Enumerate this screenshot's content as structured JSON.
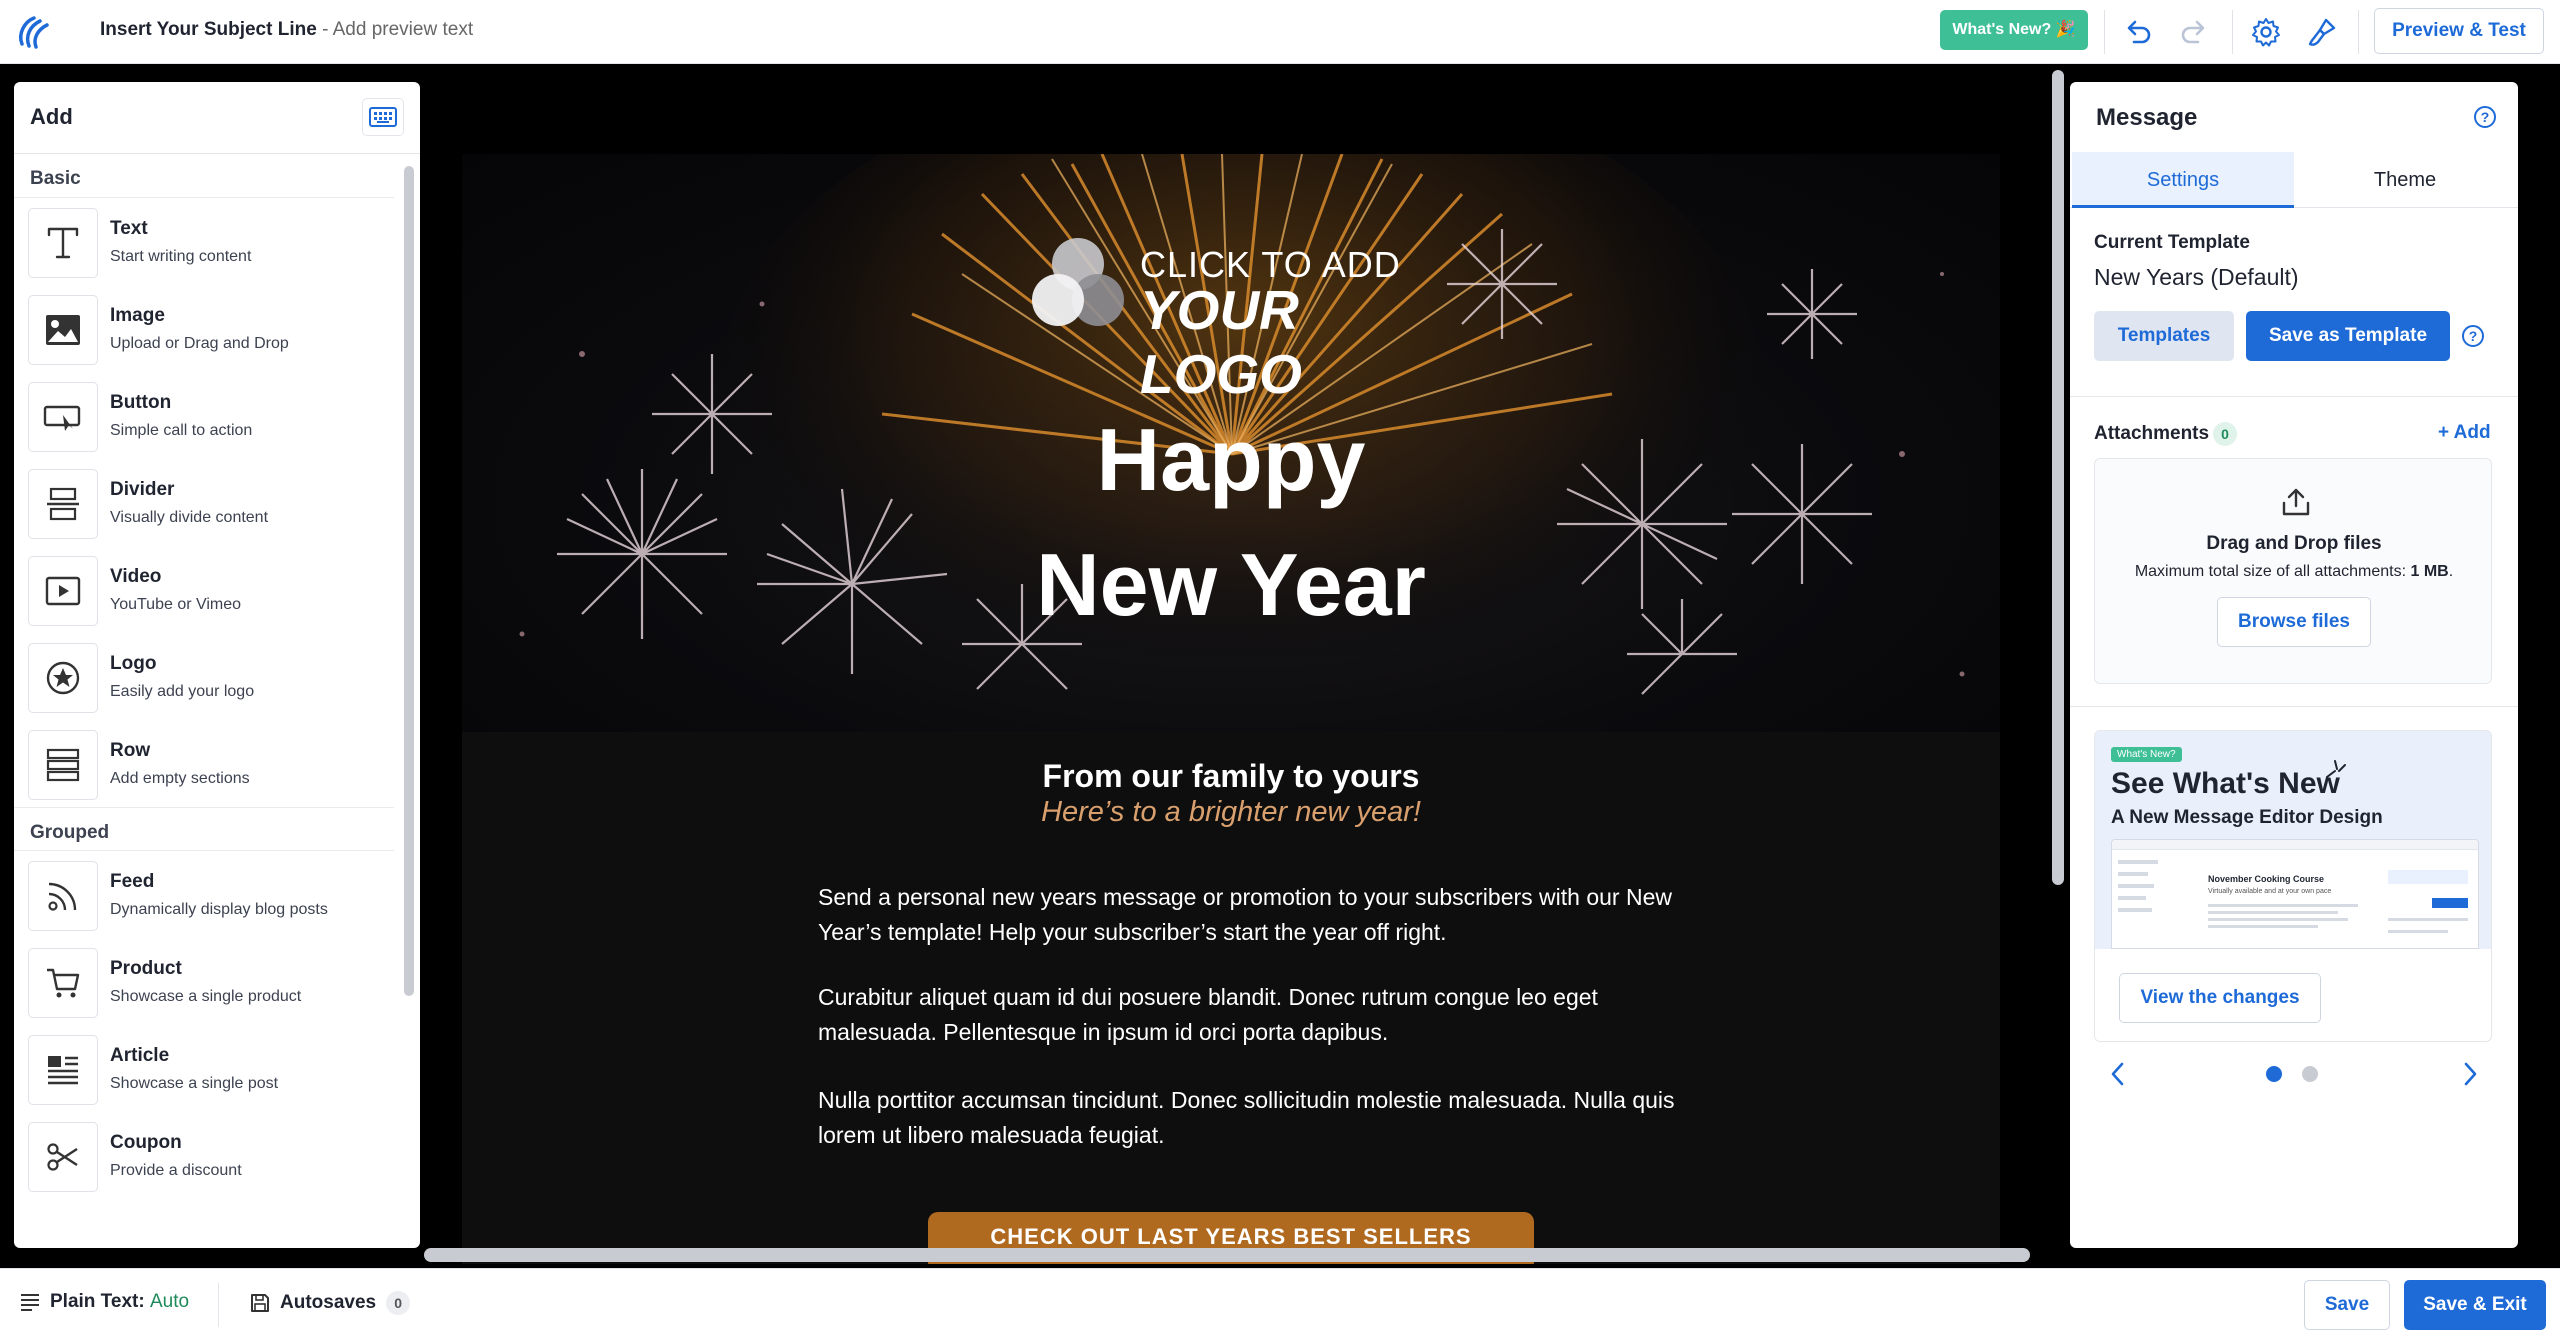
{
  "header": {
    "subject": "Insert Your Subject Line",
    "preview_text": " - Add preview text",
    "whats_new": "What's New? 🎉",
    "preview_test": "Preview & Test"
  },
  "add_panel": {
    "title": "Add",
    "sections": [
      {
        "title": "Basic",
        "items": [
          {
            "name": "Text",
            "desc": "Start writing content",
            "icon": "text-icon"
          },
          {
            "name": "Image",
            "desc": "Upload or Drag and Drop",
            "icon": "image-icon"
          },
          {
            "name": "Button",
            "desc": "Simple call to action",
            "icon": "button-icon"
          },
          {
            "name": "Divider",
            "desc": "Visually divide content",
            "icon": "divider-icon"
          },
          {
            "name": "Video",
            "desc": "YouTube or Vimeo",
            "icon": "video-icon"
          },
          {
            "name": "Logo",
            "desc": "Easily add your logo",
            "icon": "logo-icon"
          },
          {
            "name": "Row",
            "desc": "Add empty sections",
            "icon": "row-icon"
          }
        ]
      },
      {
        "title": "Grouped",
        "items": [
          {
            "name": "Feed",
            "desc": "Dynamically display blog posts",
            "icon": "rss-icon"
          },
          {
            "name": "Product",
            "desc": "Showcase a single product",
            "icon": "cart-icon"
          },
          {
            "name": "Article",
            "desc": "Showcase a single post",
            "icon": "article-icon"
          },
          {
            "name": "Coupon",
            "desc": "Provide a discount",
            "icon": "scissors-icon"
          }
        ]
      }
    ]
  },
  "email": {
    "logo_line1": "CLICK TO ADD",
    "logo_line2": "YOUR LOGO",
    "headline1": "Happy",
    "headline2": "New Year",
    "subhead": "From our family to yours",
    "tagline": "Here’s to a brighter new year!",
    "paragraphs": [
      "Send a personal new years message or promotion to your subscribers with our New Year’s template! Help your subscriber’s start the year off right.",
      "Curabitur aliquet quam id dui posuere blandit. Donec rutrum congue leo eget malesuada. Pellentesque in ipsum id orci porta dapibus.",
      "Nulla porttitor accumsan tincidunt. Donec sollicitudin molestie malesuada. Nulla quis lorem ut libero malesuada feugiat."
    ],
    "cta": "CHECK OUT LAST YEARS BEST SELLERS",
    "colors": {
      "cta": "#b06a20",
      "tagline": "#d9a06e",
      "background": "#0e0e0e"
    }
  },
  "message_panel": {
    "title": "Message",
    "tabs": [
      "Settings",
      "Theme"
    ],
    "active_tab": "Settings",
    "current_template_label": "Current Template",
    "current_template": "New Years (Default)",
    "templates_button": "Templates",
    "save_template_button": "Save as Template",
    "attachments_label": "Attachments",
    "attachments_count": "0",
    "add_link": "+ Add",
    "dropzone_title": "Drag and Drop files",
    "dropzone_sub_prefix": "Maximum total size of all attachments: ",
    "dropzone_sub_size": "1 MB",
    "dropzone_sub_suffix": ".",
    "browse_button": "Browse files",
    "promo": {
      "pill": "What's New?",
      "title": "See What's New",
      "subtitle": "A New Message Editor Design",
      "shot_heading": "November Cooking Course",
      "shot_text": "Virtually available and at your own pace",
      "button": "View the changes"
    },
    "carousel": {
      "total": 2,
      "active": 1
    }
  },
  "footer": {
    "plain_text_label": "Plain Text:",
    "plain_text_value": "Auto",
    "autosaves_label": "Autosaves",
    "autosaves_count": "0",
    "save": "Save",
    "save_exit": "Save & Exit"
  },
  "accent": "#1e6bd8"
}
